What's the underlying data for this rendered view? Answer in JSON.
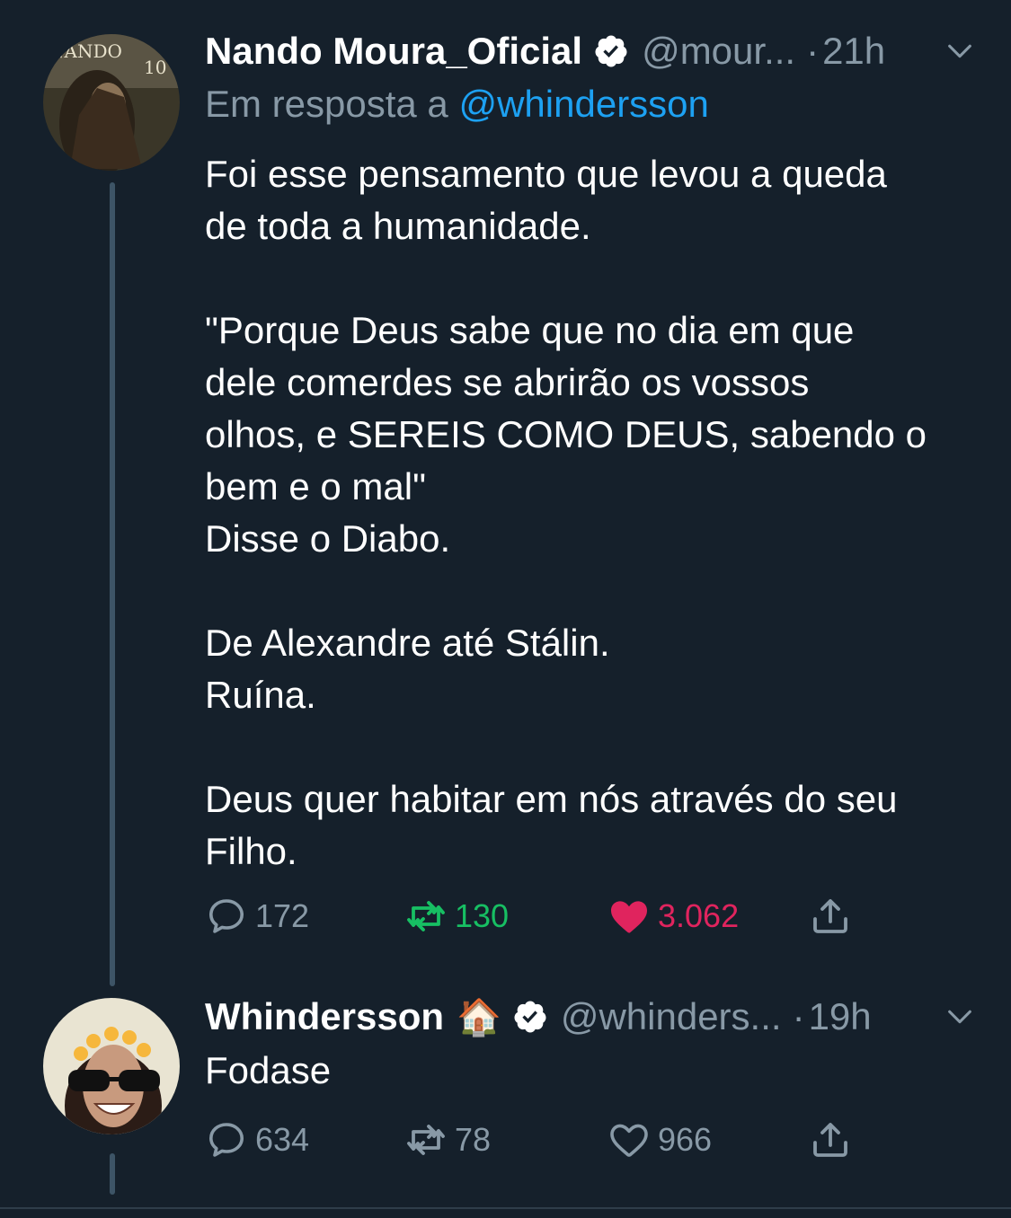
{
  "tweets": [
    {
      "name": "Nando Moura_Oficial",
      "handle": "@mour...",
      "time": "21h",
      "reply_prefix": "Em resposta a",
      "reply_mention": "@whindersson",
      "avatar_text": "NANDO",
      "avatar_number": "10",
      "body_lines": {
        "l1": "Foi esse pensamento que levou a queda",
        "l2": "de toda a humanidade.",
        "l3": "\"Porque Deus sabe que no dia em que",
        "l4": "dele comerdes se abrirão os vossos",
        "l5": "olhos, e SEREIS COMO DEUS, sabendo o",
        "l6": "bem e o mal\"",
        "l7": "Disse o Diabo.",
        "l8": "De Alexandre até Stálin.",
        "l9": "Ruína.",
        "l10": "Deus quer habitar em nós através do seu",
        "l11": "Filho."
      },
      "replies": "172",
      "retweets": "130",
      "likes": "3.062",
      "retweeted": true,
      "liked": true
    },
    {
      "name": "Whindersson",
      "name_emoji": "🏠",
      "handle": "@whinders...",
      "time": "19h",
      "body": "Fodase",
      "replies": "634",
      "retweets": "78",
      "likes": "966",
      "retweeted": false,
      "liked": false
    }
  ],
  "colors": {
    "background": "#15202b",
    "secondary_text": "#8899a6",
    "link": "#1da1f2",
    "retweet_active": "#17bf63",
    "like_active": "#e0245e"
  }
}
